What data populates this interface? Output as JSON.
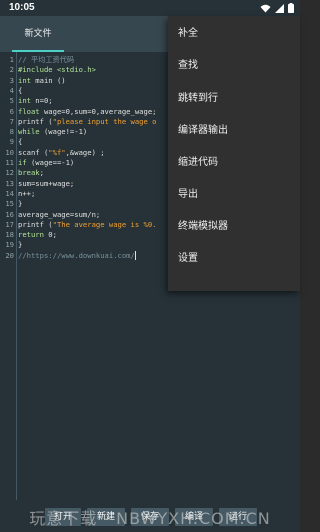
{
  "status_bar": {
    "time": "10:05"
  },
  "tabs": [
    {
      "label": "新文件"
    }
  ],
  "editor": {
    "lines": [
      {
        "n": "1",
        "segs": [
          {
            "c": "comment",
            "t": "// 平均工资代码"
          }
        ]
      },
      {
        "n": "2",
        "segs": [
          {
            "c": "kw",
            "t": "#include <stdio.h>"
          }
        ]
      },
      {
        "n": "3",
        "segs": [
          {
            "c": "kw",
            "t": "int"
          },
          {
            "c": "plain",
            "t": " main ()"
          }
        ]
      },
      {
        "n": "4",
        "segs": [
          {
            "c": "plain",
            "t": "{"
          }
        ]
      },
      {
        "n": "5",
        "segs": [
          {
            "c": "kw",
            "t": "int"
          },
          {
            "c": "plain",
            "t": " n=0;"
          }
        ]
      },
      {
        "n": "6",
        "segs": [
          {
            "c": "kw",
            "t": "float"
          },
          {
            "c": "plain",
            "t": " wage=0,sum=0,average_wage;"
          }
        ]
      },
      {
        "n": "7",
        "segs": [
          {
            "c": "plain",
            "t": "printf ("
          },
          {
            "c": "str",
            "t": "\"please input the wage o"
          }
        ]
      },
      {
        "n": "8",
        "segs": [
          {
            "c": "kw",
            "t": "while"
          },
          {
            "c": "plain",
            "t": " (wage!=-1)"
          }
        ]
      },
      {
        "n": "9",
        "segs": [
          {
            "c": "plain",
            "t": "{"
          }
        ]
      },
      {
        "n": "10",
        "segs": [
          {
            "c": "plain",
            "t": "scanf ("
          },
          {
            "c": "str",
            "t": "\"%f\""
          },
          {
            "c": "plain",
            "t": ",&wage) ;"
          }
        ]
      },
      {
        "n": "11",
        "segs": [
          {
            "c": "kw",
            "t": "if"
          },
          {
            "c": "plain",
            "t": " (wage==-1)"
          }
        ]
      },
      {
        "n": "12",
        "segs": [
          {
            "c": "kw",
            "t": "break"
          },
          {
            "c": "plain",
            "t": ";"
          }
        ]
      },
      {
        "n": "13",
        "segs": [
          {
            "c": "plain",
            "t": "sum=sum+wage;"
          }
        ]
      },
      {
        "n": "14",
        "segs": [
          {
            "c": "plain",
            "t": "n++;"
          }
        ]
      },
      {
        "n": "15",
        "segs": [
          {
            "c": "plain",
            "t": "}"
          }
        ]
      },
      {
        "n": "16",
        "segs": [
          {
            "c": "plain",
            "t": "average_wage=sum/n;"
          }
        ]
      },
      {
        "n": "17",
        "segs": [
          {
            "c": "plain",
            "t": "printf ("
          },
          {
            "c": "str",
            "t": "\"The average wage is %0."
          }
        ]
      },
      {
        "n": "18",
        "segs": [
          {
            "c": "kw",
            "t": "return"
          },
          {
            "c": "plain",
            "t": " 0;"
          }
        ]
      },
      {
        "n": "19",
        "segs": [
          {
            "c": "plain",
            "t": "}"
          }
        ]
      },
      {
        "n": "20",
        "segs": [
          {
            "c": "link",
            "t": "//https://www.downkuai.com/"
          }
        ]
      }
    ]
  },
  "menu": {
    "items": [
      {
        "label": "补全"
      },
      {
        "label": "查找"
      },
      {
        "label": "跳转到行"
      },
      {
        "label": "编译器输出"
      },
      {
        "label": "缩进代码"
      },
      {
        "label": "导出"
      },
      {
        "label": "终端模拟器"
      },
      {
        "label": "设置"
      }
    ]
  },
  "toolbar": {
    "buttons": [
      {
        "label": "打开"
      },
      {
        "label": "新建"
      },
      {
        "label": "保存"
      },
      {
        "label": "编译"
      },
      {
        "label": "运行"
      }
    ]
  },
  "watermark": {
    "text": "玩意下载 - NBWYXH.COM.CN"
  },
  "colors": {
    "editor_bg": "#263238",
    "app_bar": "#37474f",
    "tab_indicator": "#4dd0c7",
    "keyword": "#b4e39a",
    "string": "#f0a030",
    "comment": "#78909c",
    "menu_bg": "#303030",
    "button_bg": "#455a64"
  }
}
